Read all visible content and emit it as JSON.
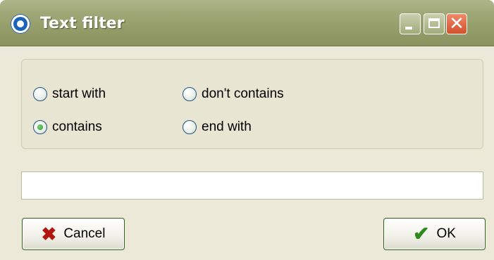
{
  "window": {
    "title": "Text filter",
    "controls": {
      "minimize_icon": "minimize-icon",
      "maximize_icon": "maximize-icon",
      "close_icon": "close-icon"
    }
  },
  "options": [
    {
      "label": "start with",
      "checked": false
    },
    {
      "label": "don't contains",
      "checked": false
    },
    {
      "label": "contains",
      "checked": true
    },
    {
      "label": "end with",
      "checked": false
    }
  ],
  "filter_input": {
    "value": "",
    "placeholder": ""
  },
  "buttons": {
    "cancel_label": "Cancel",
    "ok_label": "OK"
  },
  "colors": {
    "titlebar": "#9fa776",
    "close_button": "#d2512c",
    "window_bg": "#ece9d8",
    "radio_checked": "#2b9a25"
  }
}
